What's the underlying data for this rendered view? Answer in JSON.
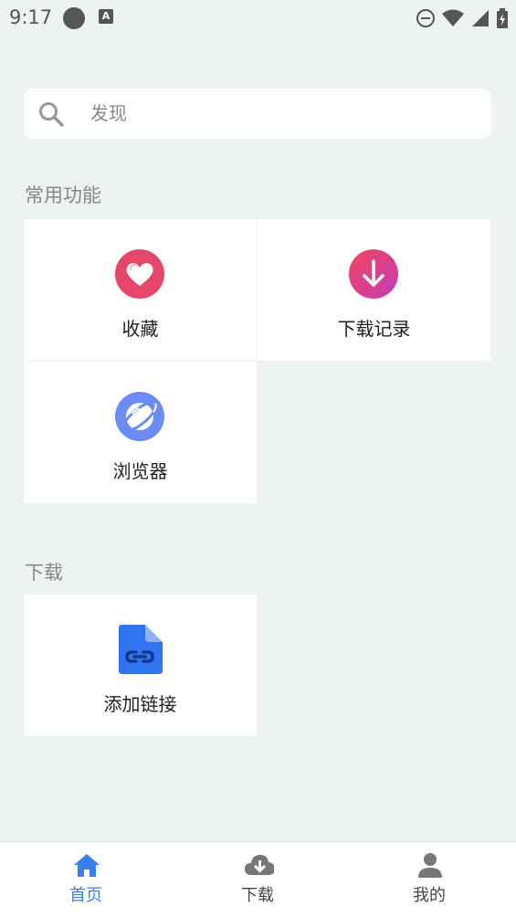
{
  "status_bar": {
    "time": "9:17",
    "badge_letter": "A"
  },
  "search": {
    "label": "发现",
    "icon": "search-icon"
  },
  "sections": {
    "common": {
      "title": "常用功能",
      "items": [
        {
          "label": "收藏",
          "icon": "heart-icon",
          "color": "#e5476b"
        },
        {
          "label": "下载记录",
          "icon": "download-arrow-icon",
          "color": "#e03c8a"
        },
        {
          "label": "浏览器",
          "icon": "planet-icon",
          "color": "#6b8cf5"
        }
      ]
    },
    "download": {
      "title": "下载",
      "items": [
        {
          "label": "添加链接",
          "icon": "link-file-icon",
          "color": "#2f74f0"
        }
      ]
    }
  },
  "bottom_nav": {
    "items": [
      {
        "label": "首页",
        "icon": "home-icon",
        "active": true
      },
      {
        "label": "下载",
        "icon": "cloud-download-icon",
        "active": false
      },
      {
        "label": "我的",
        "icon": "user-icon",
        "active": false
      }
    ],
    "active_color": "#3a7ff0"
  }
}
